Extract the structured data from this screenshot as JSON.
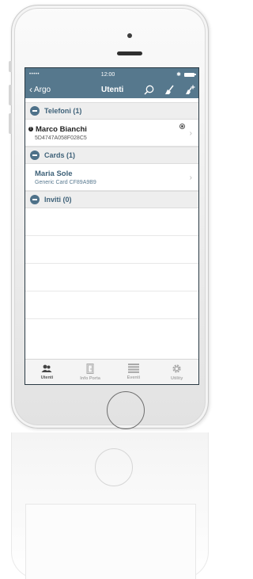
{
  "status_bar": {
    "signal": "•••••",
    "time": "12:00",
    "bluetooth": "✱"
  },
  "nav": {
    "back_label": "Argo",
    "title": "Utenti",
    "icons": [
      "search-icon",
      "broom-icon",
      "add-user-icon"
    ]
  },
  "sections": [
    {
      "title": "Telefoni (1)"
    },
    {
      "title": "Cards (1)"
    },
    {
      "title": "Inviti (0)"
    }
  ],
  "phones": [
    {
      "name": "Marco Bianchi",
      "id": "5D4747A058F028C5",
      "alert": "!"
    }
  ],
  "cards": [
    {
      "name": "Maria Sole",
      "desc": "Generic Card CF89A9B9"
    }
  ],
  "tabs": [
    {
      "label": "Utenti",
      "icon": "users-icon",
      "active": true
    },
    {
      "label": "Info Porta",
      "icon": "door-icon",
      "active": false
    },
    {
      "label": "Eventi",
      "icon": "list-icon",
      "active": false
    },
    {
      "label": "Utility",
      "icon": "gear-icon",
      "active": false
    }
  ],
  "colors": {
    "accent": "#56788d",
    "section_text": "#3e6178",
    "section_bg": "#eeeeee"
  }
}
